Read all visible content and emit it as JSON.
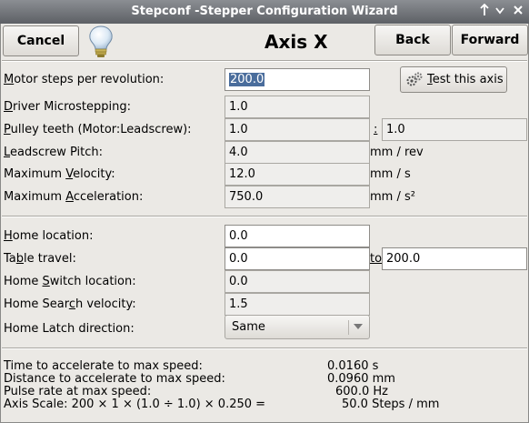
{
  "window": {
    "title": "Stepconf -Stepper Configuration Wizard",
    "controls": [
      "pin-icon",
      "minimize-icon",
      "close-icon"
    ]
  },
  "toolbar": {
    "cancel_label": "Cancel",
    "heading": "Axis X",
    "back_label": "Back",
    "forward_label": "Forward",
    "test_label_prefix": "",
    "test_label_underlined": "T",
    "test_label_rest": "est this axis"
  },
  "motion": {
    "motor_steps": {
      "label_u": "M",
      "label_rest": "otor steps per revolution:",
      "value": "200.0"
    },
    "microstepping": {
      "label_u": "D",
      "label_rest": "river Microstepping:",
      "value": "1.0"
    },
    "pulley": {
      "label_u": "P",
      "label_rest": "ulley teeth (Motor:Leadscrew):",
      "motor_value": "1.0",
      "separator": ":",
      "leadscrew_value": "1.0"
    },
    "pitch": {
      "label_u": "L",
      "label_rest": "eadscrew Pitch:",
      "value": "4.0",
      "unit": "mm / rev"
    },
    "velocity": {
      "label_pre": "Maximum ",
      "label_u": "V",
      "label_rest": "elocity:",
      "value": "12.0",
      "unit": "mm / s"
    },
    "acceleration": {
      "label_pre": "Maximum ",
      "label_u": "A",
      "label_rest": "cceleration:",
      "value": "750.0",
      "unit": "mm / s²"
    }
  },
  "homing": {
    "home_location": {
      "label_u": "H",
      "label_rest": "ome location:",
      "value": "0.0"
    },
    "table_travel": {
      "label_pre": "Ta",
      "label_u": "b",
      "label_rest": "le travel:",
      "min_value": "0.0",
      "to_u": "to",
      "max_value": "200.0"
    },
    "switch_location": {
      "label_pre": "Home ",
      "label_u": "S",
      "label_rest": "witch location:",
      "value": "0.0"
    },
    "search_velocity": {
      "label_pre": "Home Sear",
      "label_u": "c",
      "label_rest": "h velocity:",
      "value": "1.5"
    },
    "latch_direction": {
      "label": "Home Latch direction:",
      "value": "Same"
    }
  },
  "summary": {
    "accel_time": {
      "label": "Time to accelerate to max speed:",
      "value": "0.0160 s"
    },
    "accel_distance": {
      "label": "Distance to accelerate to max speed:",
      "value": "0.0960 mm"
    },
    "pulse_rate": {
      "label": "Pulse rate at max speed:",
      "value": "600.0 Hz"
    },
    "axis_scale": {
      "label": "Axis Scale: 200 × 1 × (1.0 ÷ 1.0) × 0.250 =",
      "value": "50.0 Steps / mm"
    }
  }
}
